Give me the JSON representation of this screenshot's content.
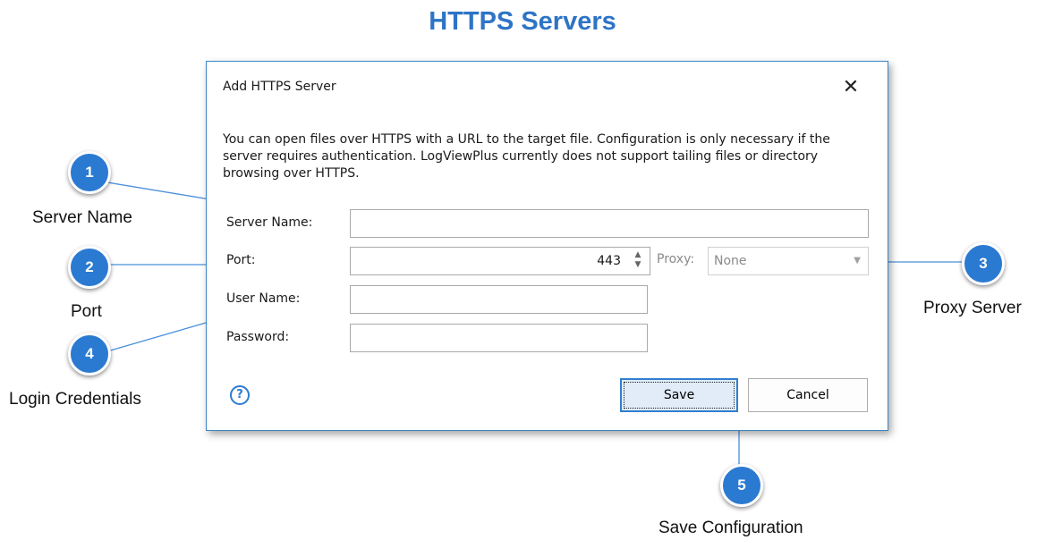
{
  "page": {
    "title": "HTTPS Servers"
  },
  "dialog": {
    "title": "Add HTTPS Server",
    "close_glyph": "✕",
    "description": "You can open files over HTTPS with a URL to the target file.  Configuration is only necessary if the server requires authentication.  LogViewPlus currently does not support tailing files or directory browsing over HTTPS.",
    "fields": {
      "server_name": {
        "label": "Server Name:",
        "value": ""
      },
      "port": {
        "label": "Port:",
        "value": "443"
      },
      "proxy": {
        "label": "Proxy:",
        "value": "None"
      },
      "user_name": {
        "label": "User Name:",
        "value": ""
      },
      "password": {
        "label": "Password:",
        "value": ""
      }
    },
    "help_glyph": "?",
    "save_label": "Save",
    "cancel_label": "Cancel"
  },
  "callouts": [
    {
      "number": "1",
      "label": "Server Name"
    },
    {
      "number": "2",
      "label": "Port"
    },
    {
      "number": "3",
      "label": "Proxy Server"
    },
    {
      "number": "4",
      "label": "Login Credentials"
    },
    {
      "number": "5",
      "label": "Save Configuration"
    }
  ],
  "colors": {
    "title": "#2e74c6",
    "badge": "#2a7ad2",
    "connector": "#4a90d9",
    "dialog_border": "#3c86c4"
  },
  "icons": {
    "help": "help-circle-icon",
    "close": "close-icon",
    "spinner": "spin-arrows-icon",
    "dropdown": "chevron-down-icon"
  }
}
